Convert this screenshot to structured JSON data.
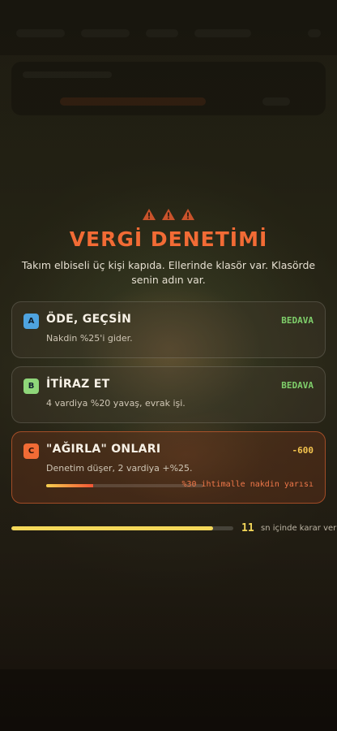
{
  "alert": {
    "warning_icons": [
      "warning-triangle",
      "warning-triangle",
      "warning-triangle"
    ],
    "title": "VERGİ DENETİMİ",
    "message": "Takım elbiseli üç kişi kapıda. Ellerinde klasör var. Klasörde senin adın var."
  },
  "options": [
    {
      "key": "A",
      "key_color": "#4ea3e0",
      "title": "ÖDE, GEÇSİN",
      "cost": "BEDAVA",
      "cost_color": "#7fcf6b",
      "description": "Nakdin %25'i gider."
    },
    {
      "key": "B",
      "key_color": "#8fd67a",
      "title": "İTİRAZ ET",
      "cost": "BEDAVA",
      "cost_color": "#7fcf6b",
      "description": "4 vardiya %20 yavaş, evrak işi."
    },
    {
      "key": "C",
      "key_color": "#f26b35",
      "title": "\"AĞIRLA\" ONLARI",
      "cost": "-600",
      "cost_color": "#f4c44e",
      "description": "Denetim düşer, 2 vardiya +%25.",
      "risk_fraction": 0.3,
      "risk_label": "%30 ihtimalle nakdin yarısı"
    }
  ],
  "timer": {
    "seconds": "11",
    "label": "sn içinde karar ver",
    "remaining_fraction": 0.91
  },
  "colors": {
    "accent": "#f26b35",
    "timer": "#f4d85a"
  }
}
